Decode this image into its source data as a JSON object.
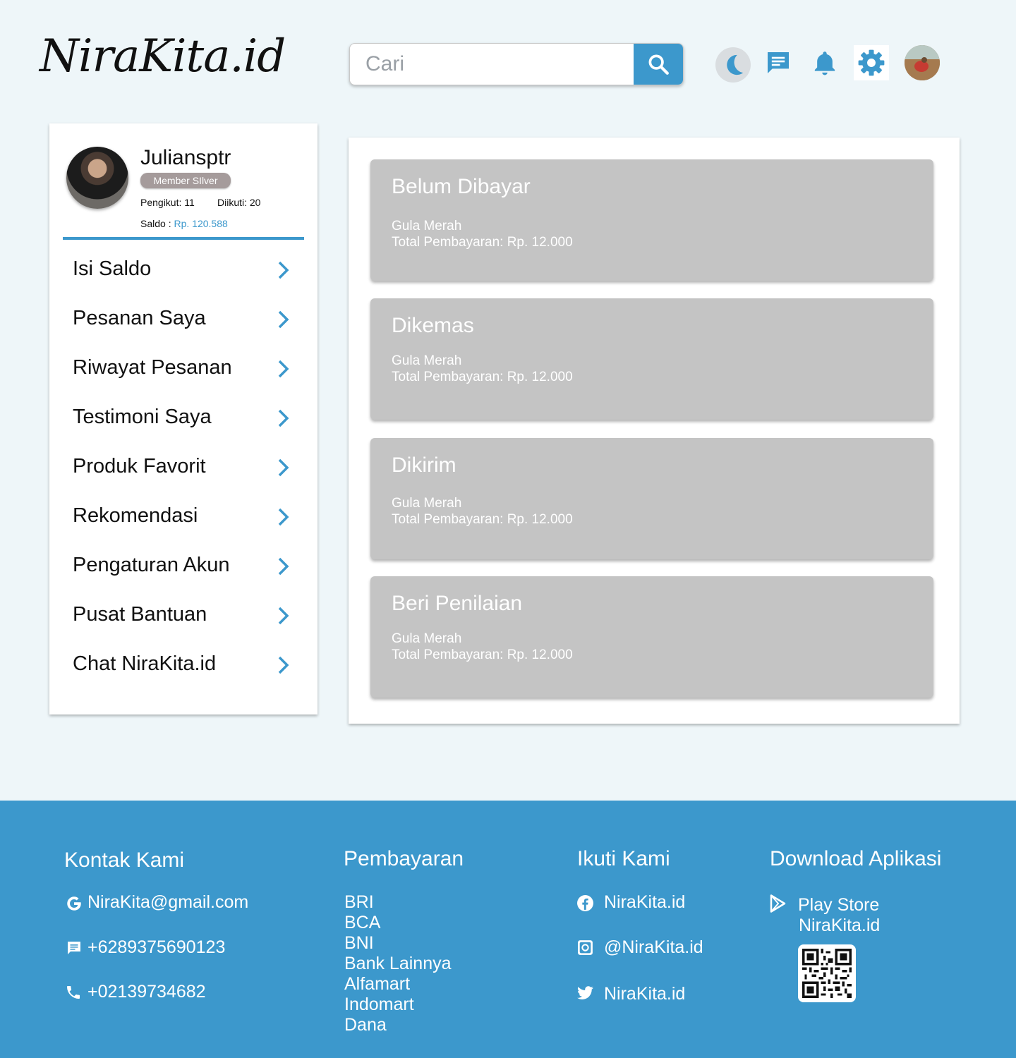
{
  "header": {
    "logo": "NiraKita.id",
    "search": {
      "placeholder": "Cari",
      "value": ""
    }
  },
  "icons": {
    "accent": "#3c98cc",
    "dark_mode": "moon-icon",
    "messages": "chat-icon",
    "notifications": "bell-icon",
    "settings": "gear-icon",
    "account": "avatar"
  },
  "profile": {
    "name": "Juliansptr",
    "badge": "Member SIlver",
    "followers": "Pengikut: 11",
    "following": "Diikuti: 20",
    "saldo_label": "Saldo : ",
    "saldo_value": "Rp. 120.588"
  },
  "menu": [
    {
      "label": "Isi Saldo"
    },
    {
      "label": "Pesanan Saya"
    },
    {
      "label": "Riwayat Pesanan"
    },
    {
      "label": "Testimoni Saya"
    },
    {
      "label": "Produk Favorit"
    },
    {
      "label": "Rekomendasi"
    },
    {
      "label": "Pengaturan Akun"
    },
    {
      "label": "Pusat Bantuan"
    },
    {
      "label": "Chat NiraKita.id"
    }
  ],
  "orders": [
    {
      "status": "Belum Dibayar",
      "product": "Gula Merah",
      "total": "Total Pembayaran:  Rp. 12.000"
    },
    {
      "status": "Dikemas",
      "product": "Gula Merah",
      "total": "Total Pembayaran:  Rp. 12.000"
    },
    {
      "status": "Dikirim",
      "product": "Gula Merah",
      "total": "Total Pembayaran:  Rp. 12.000"
    },
    {
      "status": "Beri Penilaian",
      "product": "Gula Merah",
      "total": "Total Pembayaran:  Rp. 12.000"
    }
  ],
  "footer": {
    "contact": {
      "heading": "Kontak Kami",
      "email": "NiraKita@gmail.com",
      "sms": "+6289375690123",
      "phone": "+02139734682"
    },
    "payment": {
      "heading": "Pembayaran",
      "items": [
        "BRI",
        "BCA",
        "BNI",
        "Bank Lainnya",
        "Alfamart",
        "Indomart",
        "Dana"
      ]
    },
    "follow": {
      "heading": "Ikuti Kami",
      "facebook": "NiraKita.id",
      "instagram": "@NiraKita.id",
      "twitter": "NiraKita.id"
    },
    "download": {
      "heading": "Download Aplikasi",
      "store": "Play Store",
      "app_name": "NiraKita.id"
    }
  }
}
